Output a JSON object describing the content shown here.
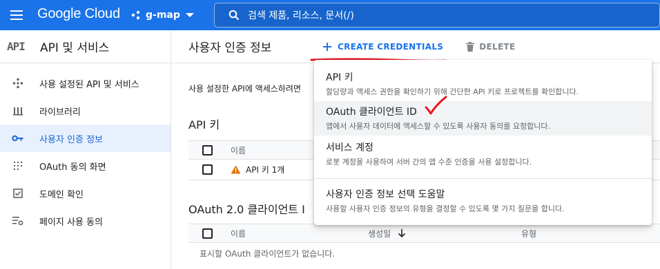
{
  "topbar": {
    "logo": "Google Cloud",
    "project": "g-map",
    "search_text": "검색  제품, 리소스, 문서(/)"
  },
  "sidebar": {
    "badge": "API",
    "title": "API 및 서비스",
    "items": [
      {
        "label": "사용 설정된 API 및 서비스",
        "icon": "diamond-icon",
        "active": false
      },
      {
        "label": "라이브러리",
        "icon": "library-icon",
        "active": false
      },
      {
        "label": "사용자 인증 정보",
        "icon": "key-icon",
        "active": true
      },
      {
        "label": "OAuth 동의 화면",
        "icon": "dots-grid-icon",
        "active": false
      },
      {
        "label": "도메인 확인",
        "icon": "checkbox-icon",
        "active": false
      },
      {
        "label": "페이지 사용 동의",
        "icon": "settings-list-icon",
        "active": false
      }
    ]
  },
  "main": {
    "title": "사용자 인증 정보",
    "create_label": "CREATE CREDENTIALS",
    "delete_label": "DELETE",
    "description": "사용 설정한 API에 액세스하려면",
    "api_keys": {
      "heading": "API 키",
      "col_name": "이름",
      "row_name": "API 키 1개"
    },
    "oauth": {
      "heading": "OAuth 2.0 클라이언트 I",
      "col_name": "이름",
      "col_created": "생성일",
      "col_type": "유형",
      "empty": "표시할 OAuth 클라이언트가 없습니다."
    }
  },
  "dropdown": {
    "items": [
      {
        "title": "API 키",
        "sub": "할당량과 액세스 권한을 확인하기 위해 간단한 API 키로 프로젝트를 확인합니다."
      },
      {
        "title": "OAuth 클라이언트 ID",
        "sub": "앱에서 사용자 데이터에 액세스할 수 있도록 사용자 동의를 요청합니다."
      },
      {
        "title": "서비스 계정",
        "sub": "로봇 계정을 사용하여 서버 간의 앱 수준 인증을 사용 설정합니다."
      },
      {
        "title": "사용자 인증 정보 선택 도움말",
        "sub": "사용할 사용자 인증 정보의 유형을 결정할 수 있도록 몇 가지 질문을 합니다."
      }
    ]
  },
  "colors": {
    "brand": "#1a73e8",
    "active_bg": "#e8f0fe",
    "annotation": "#e8131a",
    "warning": "#e37400"
  }
}
